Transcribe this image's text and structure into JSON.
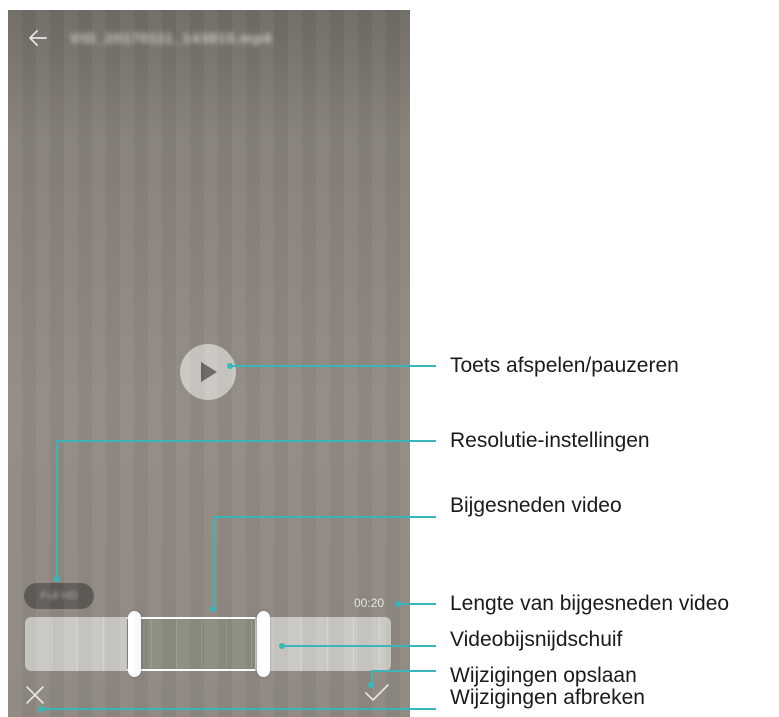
{
  "video": {
    "filename": "VID_20170111_143015.mp4",
    "resolution_label": "Full HD",
    "trimmed_duration": "00:20"
  },
  "callouts": {
    "play_pause": "Toets afspelen/pauzeren",
    "resolution": "Resolutie-instellingen",
    "trimmed_video": "Bijgesneden video",
    "trimmed_length": "Lengte van bijgesneden video",
    "trim_slider": "Videobijsnijdschuif",
    "save_changes": "Wijzigingen opslaan",
    "cancel_changes": "Wijzigingen afbreken"
  },
  "icons": {
    "back": "arrow-left-icon",
    "play": "play-icon",
    "save": "checkmark-icon",
    "cancel": "close-icon"
  },
  "colors": {
    "callout": "#39b6ba",
    "selection": "#8b8c7f"
  }
}
